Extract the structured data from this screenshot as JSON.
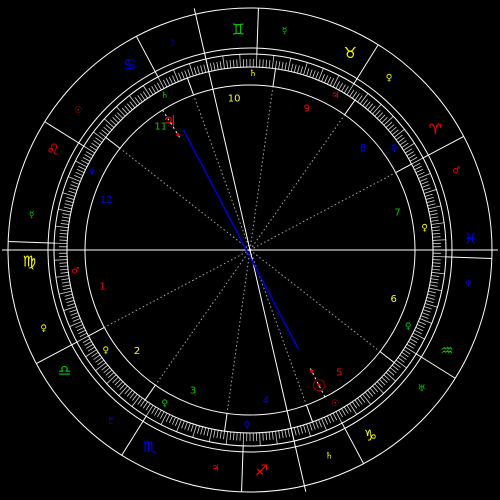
{
  "colors": {
    "background": "#000000",
    "frame": "#ffffff",
    "hatch": "#d4d4d4",
    "dotted": "#aaaaaa",
    "aspect_line": "#0000cc",
    "fire": "#ff0000",
    "earth": "#ffff00",
    "air": "#00cc00",
    "water": "#0000ff",
    "house_number": "#ffff00"
  },
  "chart": {
    "zodiac_signs": [
      {
        "name": "sagittarius",
        "glyph": "♐",
        "element": "fire"
      },
      {
        "name": "scorpio",
        "glyph": "♏",
        "element": "water"
      },
      {
        "name": "libra",
        "glyph": "♎",
        "element": "air"
      },
      {
        "name": "virgo",
        "glyph": "♍",
        "element": "earth"
      },
      {
        "name": "leo",
        "glyph": "♌",
        "element": "fire"
      },
      {
        "name": "cancer",
        "glyph": "♋",
        "element": "water"
      },
      {
        "name": "gemini",
        "glyph": "♊",
        "element": "air"
      },
      {
        "name": "taurus",
        "glyph": "♉",
        "element": "earth"
      },
      {
        "name": "aries",
        "glyph": "♈",
        "element": "fire"
      },
      {
        "name": "pisces",
        "glyph": "♓",
        "element": "water"
      },
      {
        "name": "aquarius",
        "glyph": "♒",
        "element": "air"
      },
      {
        "name": "capricorn",
        "glyph": "♑",
        "element": "earth"
      }
    ],
    "ruler_glyphs": [
      {
        "glyph": "♃",
        "element": "fire"
      },
      {
        "glyph": "♇",
        "element": "water"
      },
      {
        "glyph": "♀",
        "element": "earth"
      },
      {
        "glyph": "☿",
        "element": "air"
      },
      {
        "glyph": "☉",
        "element": "fire"
      },
      {
        "glyph": "☽",
        "element": "water"
      },
      {
        "glyph": "☿",
        "element": "air"
      },
      {
        "glyph": "♀",
        "element": "earth"
      },
      {
        "glyph": "♂",
        "element": "fire"
      },
      {
        "glyph": "♆",
        "element": "water"
      },
      {
        "glyph": "♅",
        "element": "air"
      },
      {
        "glyph": "♄",
        "element": "earth"
      }
    ],
    "houses": [
      {
        "number": "1",
        "color": "fire"
      },
      {
        "number": "2",
        "color": "house_number"
      },
      {
        "number": "3",
        "color": "air"
      },
      {
        "number": "4",
        "color": "water"
      },
      {
        "number": "5",
        "color": "fire"
      },
      {
        "number": "6",
        "color": "house_number"
      },
      {
        "number": "7",
        "color": "air"
      },
      {
        "number": "8",
        "color": "water"
      },
      {
        "number": "9",
        "color": "fire"
      },
      {
        "number": "10",
        "color": "house_number"
      },
      {
        "number": "11",
        "color": "air"
      },
      {
        "number": "12",
        "color": "water"
      }
    ],
    "house_rulers": [
      {
        "glyph": "♂",
        "color": "fire"
      },
      {
        "glyph": "♀",
        "color": "house_number"
      },
      {
        "glyph": "♀",
        "color": "air"
      },
      {
        "glyph": "♀",
        "color": "water"
      },
      {
        "glyph": "☉",
        "color": "fire"
      },
      {
        "glyph": "♀",
        "color": "air"
      },
      {
        "glyph": "♀",
        "color": "house_number"
      },
      {
        "glyph": "♀",
        "color": "water"
      },
      {
        "glyph": "♃",
        "color": "fire"
      },
      {
        "glyph": "♄",
        "color": "house_number"
      },
      {
        "glyph": "♄",
        "color": "air"
      },
      {
        "glyph": "♆",
        "color": "water"
      }
    ],
    "planets": [
      {
        "name": "jupiter",
        "glyph": "♃",
        "color": "fire"
      },
      {
        "name": "sun",
        "glyph": "☉",
        "color": "fire"
      }
    ]
  }
}
